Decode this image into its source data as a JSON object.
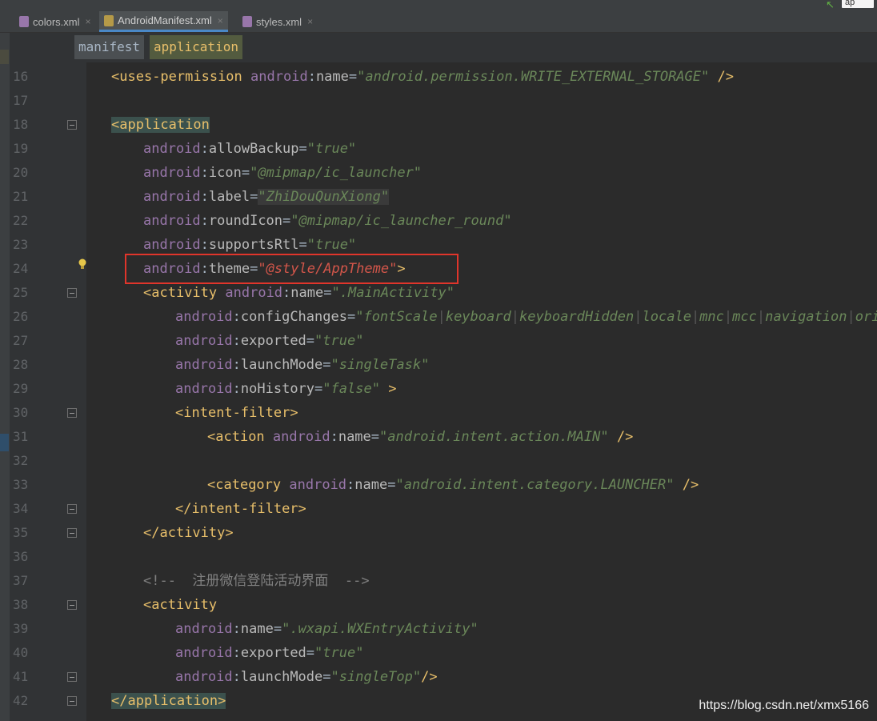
{
  "tabs": [
    {
      "label": "colors.xml",
      "icon": "xml-file-icon",
      "active": false
    },
    {
      "label": "AndroidManifest.xml",
      "icon": "manifest-file-icon",
      "active": true
    },
    {
      "label": "styles.xml",
      "icon": "xml-file-icon",
      "active": false
    }
  ],
  "close_glyph": "×",
  "top_right": {
    "label": "ap"
  },
  "breadcrumbs": [
    "manifest",
    "application"
  ],
  "editor": {
    "lines": [
      {
        "num": "16",
        "indent": 1,
        "tokens": [
          [
            "br",
            "<"
          ],
          [
            "tag",
            "uses-permission"
          ],
          [
            "sp",
            " "
          ],
          [
            "ns",
            "android"
          ],
          [
            "eq",
            ":"
          ],
          [
            "attr",
            "name"
          ],
          [
            "eq",
            "="
          ],
          [
            "val",
            "\"android.permission.WRITE_EXTERNAL_STORAGE\""
          ],
          [
            "sp",
            " "
          ],
          [
            "br",
            "/>"
          ]
        ]
      },
      {
        "num": "17",
        "indent": 0,
        "tokens": []
      },
      {
        "num": "18",
        "indent": 1,
        "fold": "open",
        "tokens": [
          [
            "br-hl",
            "<"
          ],
          [
            "tag-hl",
            "application"
          ]
        ]
      },
      {
        "num": "19",
        "indent": 2,
        "tokens": [
          [
            "ns",
            "android"
          ],
          [
            "eq",
            ":"
          ],
          [
            "attr",
            "allowBackup"
          ],
          [
            "eq",
            "="
          ],
          [
            "val",
            "\"true\""
          ]
        ]
      },
      {
        "num": "20",
        "indent": 2,
        "tokens": [
          [
            "ns",
            "android"
          ],
          [
            "eq",
            ":"
          ],
          [
            "attr",
            "icon"
          ],
          [
            "eq",
            "="
          ],
          [
            "val",
            "\"@mipmap/ic_launcher\""
          ]
        ]
      },
      {
        "num": "21",
        "indent": 2,
        "tokens": [
          [
            "ns",
            "android"
          ],
          [
            "eq",
            ":"
          ],
          [
            "attr",
            "label"
          ],
          [
            "eq",
            "="
          ],
          [
            "val-box",
            "\"ZhiDouQunXiong\""
          ]
        ]
      },
      {
        "num": "22",
        "indent": 2,
        "tokens": [
          [
            "ns",
            "android"
          ],
          [
            "eq",
            ":"
          ],
          [
            "attr",
            "roundIcon"
          ],
          [
            "eq",
            "="
          ],
          [
            "val",
            "\"@mipmap/ic_launcher_round\""
          ]
        ]
      },
      {
        "num": "23",
        "indent": 2,
        "tokens": [
          [
            "ns",
            "android"
          ],
          [
            "eq",
            ":"
          ],
          [
            "attr",
            "supportsRtl"
          ],
          [
            "eq",
            "="
          ],
          [
            "val",
            "\"true\""
          ]
        ]
      },
      {
        "num": "24",
        "indent": 2,
        "bulb": true,
        "tokens": [
          [
            "ns",
            "android"
          ],
          [
            "eq",
            ":"
          ],
          [
            "attr",
            "theme"
          ],
          [
            "eq",
            "="
          ],
          [
            "valred",
            "\"@style/AppTheme\""
          ],
          [
            "br",
            ">"
          ]
        ]
      },
      {
        "num": "25",
        "indent": 2,
        "fold": "open",
        "tokens": [
          [
            "br",
            "<"
          ],
          [
            "tag",
            "activity"
          ],
          [
            "sp",
            " "
          ],
          [
            "ns",
            "android"
          ],
          [
            "eq",
            ":"
          ],
          [
            "attr",
            "name"
          ],
          [
            "eq",
            "="
          ],
          [
            "val",
            "\".MainActivity\""
          ]
        ]
      },
      {
        "num": "26",
        "indent": 3,
        "tokens": [
          [
            "ns",
            "android"
          ],
          [
            "eq",
            ":"
          ],
          [
            "attr",
            "configChanges"
          ],
          [
            "eq",
            "="
          ],
          [
            "val",
            "\"fontScale"
          ],
          [
            "sep",
            "|"
          ],
          [
            "val",
            "keyboard"
          ],
          [
            "sep",
            "|"
          ],
          [
            "val",
            "keyboardHidden"
          ],
          [
            "sep",
            "|"
          ],
          [
            "val",
            "locale"
          ],
          [
            "sep",
            "|"
          ],
          [
            "val",
            "mnc"
          ],
          [
            "sep",
            "|"
          ],
          [
            "val",
            "mcc"
          ],
          [
            "sep",
            "|"
          ],
          [
            "val",
            "navigation"
          ],
          [
            "sep",
            "|"
          ],
          [
            "val",
            "orien"
          ]
        ]
      },
      {
        "num": "27",
        "indent": 3,
        "tokens": [
          [
            "ns",
            "android"
          ],
          [
            "eq",
            ":"
          ],
          [
            "attr",
            "exported"
          ],
          [
            "eq",
            "="
          ],
          [
            "val",
            "\"true\""
          ]
        ]
      },
      {
        "num": "28",
        "indent": 3,
        "tokens": [
          [
            "ns",
            "android"
          ],
          [
            "eq",
            ":"
          ],
          [
            "attr",
            "launchMode"
          ],
          [
            "eq",
            "="
          ],
          [
            "val",
            "\"singleTask\""
          ]
        ]
      },
      {
        "num": "29",
        "indent": 3,
        "tokens": [
          [
            "ns",
            "android"
          ],
          [
            "eq",
            ":"
          ],
          [
            "attr",
            "noHistory"
          ],
          [
            "eq",
            "="
          ],
          [
            "val",
            "\"false\""
          ],
          [
            "sp",
            " "
          ],
          [
            "br",
            ">"
          ]
        ]
      },
      {
        "num": "30",
        "indent": 3,
        "fold": "open",
        "tokens": [
          [
            "br",
            "<"
          ],
          [
            "tag",
            "intent-filter"
          ],
          [
            "br",
            ">"
          ]
        ]
      },
      {
        "num": "31",
        "indent": 4,
        "tokens": [
          [
            "br",
            "<"
          ],
          [
            "tag",
            "action"
          ],
          [
            "sp",
            " "
          ],
          [
            "ns",
            "android"
          ],
          [
            "eq",
            ":"
          ],
          [
            "attr",
            "name"
          ],
          [
            "eq",
            "="
          ],
          [
            "val",
            "\"android.intent.action.MAIN\""
          ],
          [
            "sp",
            " "
          ],
          [
            "br",
            "/>"
          ]
        ]
      },
      {
        "num": "32",
        "indent": 0,
        "tokens": []
      },
      {
        "num": "33",
        "indent": 4,
        "tokens": [
          [
            "br",
            "<"
          ],
          [
            "tag",
            "category"
          ],
          [
            "sp",
            " "
          ],
          [
            "ns",
            "android"
          ],
          [
            "eq",
            ":"
          ],
          [
            "attr",
            "name"
          ],
          [
            "eq",
            "="
          ],
          [
            "val",
            "\"android.intent.category.LAUNCHER\""
          ],
          [
            "sp",
            " "
          ],
          [
            "br",
            "/>"
          ]
        ]
      },
      {
        "num": "34",
        "indent": 3,
        "fold": "close",
        "tokens": [
          [
            "br",
            "</"
          ],
          [
            "tag",
            "intent-filter"
          ],
          [
            "br",
            ">"
          ]
        ]
      },
      {
        "num": "35",
        "indent": 2,
        "fold": "close",
        "tokens": [
          [
            "br",
            "</"
          ],
          [
            "tag",
            "activity"
          ],
          [
            "br",
            ">"
          ]
        ]
      },
      {
        "num": "36",
        "indent": 0,
        "tokens": []
      },
      {
        "num": "37",
        "indent": 2,
        "tokens": [
          [
            "com",
            "<!--  注册微信登陆活动界面  -->"
          ]
        ]
      },
      {
        "num": "38",
        "indent": 2,
        "fold": "open",
        "tokens": [
          [
            "br",
            "<"
          ],
          [
            "tag",
            "activity"
          ]
        ]
      },
      {
        "num": "39",
        "indent": 3,
        "tokens": [
          [
            "ns",
            "android"
          ],
          [
            "eq",
            ":"
          ],
          [
            "attr",
            "name"
          ],
          [
            "eq",
            "="
          ],
          [
            "val",
            "\".wxapi.WXEntryActivity\""
          ]
        ]
      },
      {
        "num": "40",
        "indent": 3,
        "tokens": [
          [
            "ns",
            "android"
          ],
          [
            "eq",
            ":"
          ],
          [
            "attr",
            "exported"
          ],
          [
            "eq",
            "="
          ],
          [
            "val",
            "\"true\""
          ]
        ]
      },
      {
        "num": "41",
        "indent": 3,
        "fold": "close",
        "tokens": [
          [
            "ns",
            "android"
          ],
          [
            "eq",
            ":"
          ],
          [
            "attr",
            "launchMode"
          ],
          [
            "eq",
            "="
          ],
          [
            "val",
            "\"singleTop\""
          ],
          [
            "br",
            "/>"
          ]
        ]
      },
      {
        "num": "42",
        "indent": 1,
        "fold": "close",
        "tokens": [
          [
            "br-hl",
            "</"
          ],
          [
            "tag-hl",
            "application"
          ],
          [
            "br-hl",
            ">"
          ]
        ]
      }
    ]
  },
  "watermark": "https://blog.csdn.net/xmx5166",
  "colors": {
    "tag": "#e8bf6a",
    "namespace": "#9876aa",
    "value": "#6a8759",
    "highlight_value": "#d3564a",
    "annotation_box": "#e0352b"
  }
}
